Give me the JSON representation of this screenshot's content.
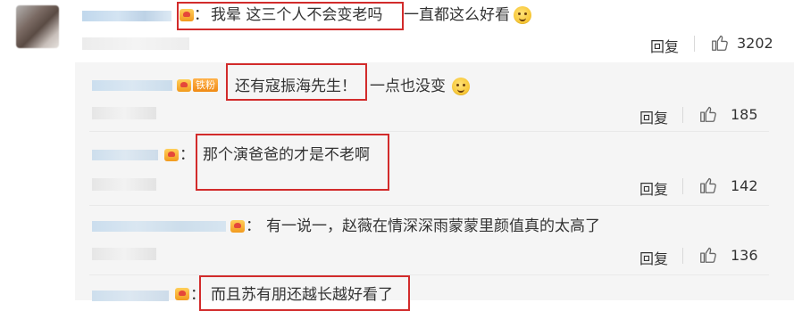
{
  "main_comment": {
    "text_boxed": "我晕 这三个人不会变老吗",
    "text_rest": "一直都这么好看",
    "colon": "：",
    "reply_label": "回复",
    "likes": "3202"
  },
  "replies": [
    {
      "text_boxed": "还有寇振海先生！",
      "text_rest": "一点也没变",
      "colon": "",
      "fan_tag": "铁粉",
      "reply_label": "回复",
      "likes": "185"
    },
    {
      "text_boxed": "那个演爸爸的才是不老啊",
      "colon": "：",
      "reply_label": "回复",
      "likes": "142"
    },
    {
      "text": "有一说一，赵薇在情深深雨蒙蒙里颜值真的太高了",
      "colon": "：",
      "reply_label": "回复",
      "likes": "136"
    },
    {
      "text_boxed": "而且苏有朋还越长越好看了",
      "colon": "："
    }
  ],
  "colors": {
    "highlight_box": "#d22b2b",
    "panel_bg": "#f5f5f5",
    "username_blur": "#b9d3ea"
  }
}
